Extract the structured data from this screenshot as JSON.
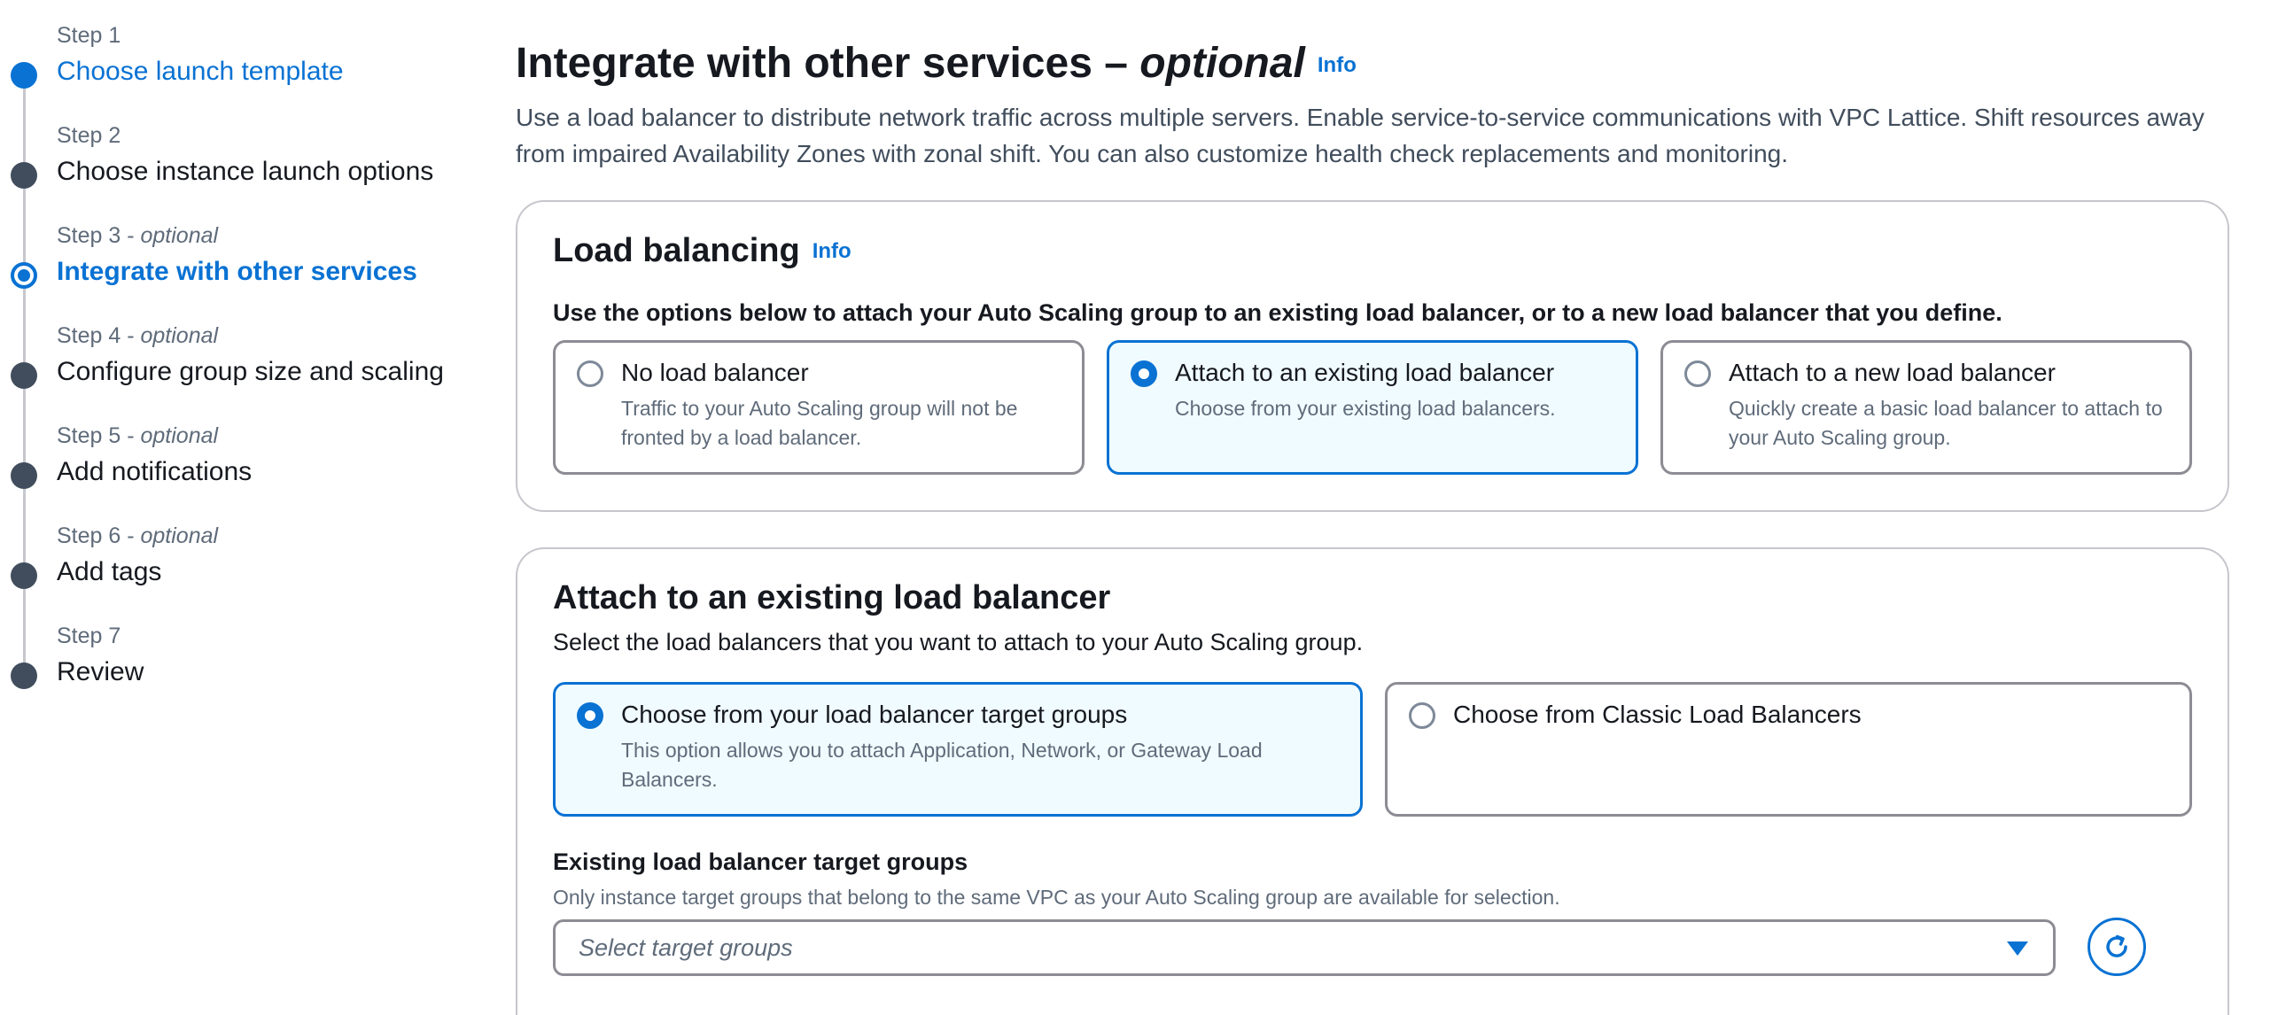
{
  "steps": [
    {
      "num": "Step 1",
      "opt": "",
      "title": "Choose launch template"
    },
    {
      "num": "Step 2",
      "opt": "",
      "title": "Choose instance launch options"
    },
    {
      "num": "Step 3 - ",
      "opt": "optional",
      "title": "Integrate with other services"
    },
    {
      "num": "Step 4 - ",
      "opt": "optional",
      "title": "Configure group size and scaling"
    },
    {
      "num": "Step 5 - ",
      "opt": "optional",
      "title": "Add notifications"
    },
    {
      "num": "Step 6 - ",
      "opt": "optional",
      "title": "Add tags"
    },
    {
      "num": "Step 7",
      "opt": "",
      "title": "Review"
    }
  ],
  "header": {
    "title": "Integrate with other services – ",
    "title_optional": "optional",
    "info": "Info",
    "description": "Use a load balancer to distribute network traffic across multiple servers. Enable service-to-service communications with VPC Lattice. Shift resources away from impaired Availability Zones with zonal shift. You can also customize health check replacements and monitoring."
  },
  "load_balancing": {
    "title": "Load balancing",
    "info": "Info",
    "lead": "Use the options below to attach your Auto Scaling group to an existing load balancer, or to a new load balancer that you define.",
    "options": [
      {
        "label": "No load balancer",
        "desc": "Traffic to your Auto Scaling group will not be fronted by a load balancer.",
        "selected": false
      },
      {
        "label": "Attach to an existing load balancer",
        "desc": "Choose from your existing load balancers.",
        "selected": true
      },
      {
        "label": "Attach to a new load balancer",
        "desc": "Quickly create a basic load balancer to attach to your Auto Scaling group.",
        "selected": false
      }
    ]
  },
  "attach": {
    "title": "Attach to an existing load balancer",
    "lead": "Select the load balancers that you want to attach to your Auto Scaling group.",
    "options": [
      {
        "label": "Choose from your load balancer target groups",
        "desc": "This option allows you to attach Application, Network, or Gateway Load Balancers.",
        "selected": true
      },
      {
        "label": "Choose from Classic Load Balancers",
        "desc": "",
        "selected": false
      }
    ],
    "field_label": "Existing load balancer target groups",
    "field_hint": "Only instance target groups that belong to the same VPC as your Auto Scaling group are available for selection.",
    "select_placeholder": "Select target groups"
  },
  "icons": {
    "refresh": "refresh-icon",
    "caret": "caret-down-icon"
  },
  "colors": {
    "accent": "#0972d3",
    "text": "#16191f",
    "muted": "#5f6b7a",
    "border": "#8c8c94"
  }
}
